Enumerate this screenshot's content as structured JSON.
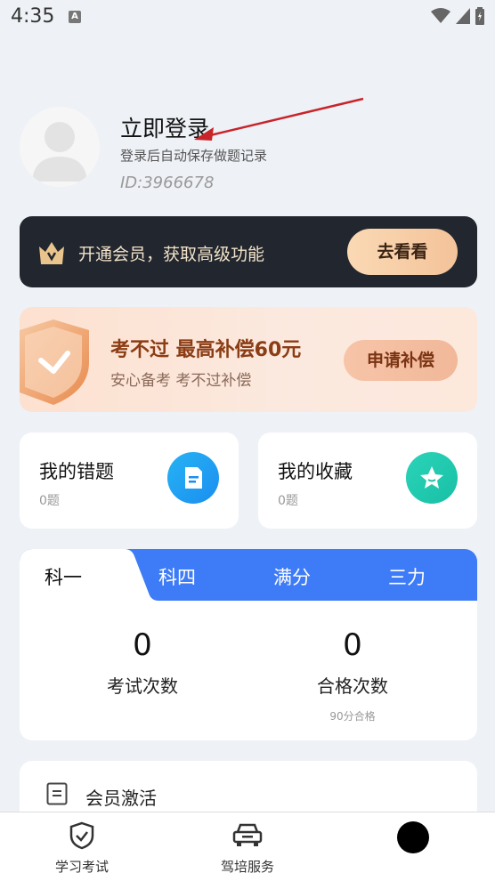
{
  "status_bar": {
    "time": "4:35",
    "notification_icon": "A"
  },
  "profile": {
    "title": "立即登录",
    "subtitle": "登录后自动保存做题记录",
    "user_id": "ID:3966678"
  },
  "vip_banner": {
    "text": "开通会员，获取高级功能",
    "button": "去看看"
  },
  "comp_banner": {
    "title": "考不过 最高补偿60元",
    "subtitle": "安心备考 考不过补偿",
    "button": "申请补偿"
  },
  "cards": {
    "wrong": {
      "title": "我的错题",
      "count": "0题"
    },
    "favorites": {
      "title": "我的收藏",
      "count": "0题"
    }
  },
  "stats": {
    "tabs": [
      "科一",
      "科四",
      "满分",
      "三力"
    ],
    "active_tab": 0,
    "exam_count": {
      "value": "0",
      "label": "考试次数"
    },
    "pass_count": {
      "value": "0",
      "label": "合格次数",
      "note": "90分合格"
    }
  },
  "activation": {
    "label": "会员激活"
  },
  "bottom_nav": [
    {
      "label": "学习考试",
      "icon": "shield-check-icon"
    },
    {
      "label": "驾培服务",
      "icon": "car-icon"
    }
  ],
  "colors": {
    "accent": "#3e7bf6",
    "dark_banner": "#22262e",
    "comp_text": "#8b3d14"
  }
}
